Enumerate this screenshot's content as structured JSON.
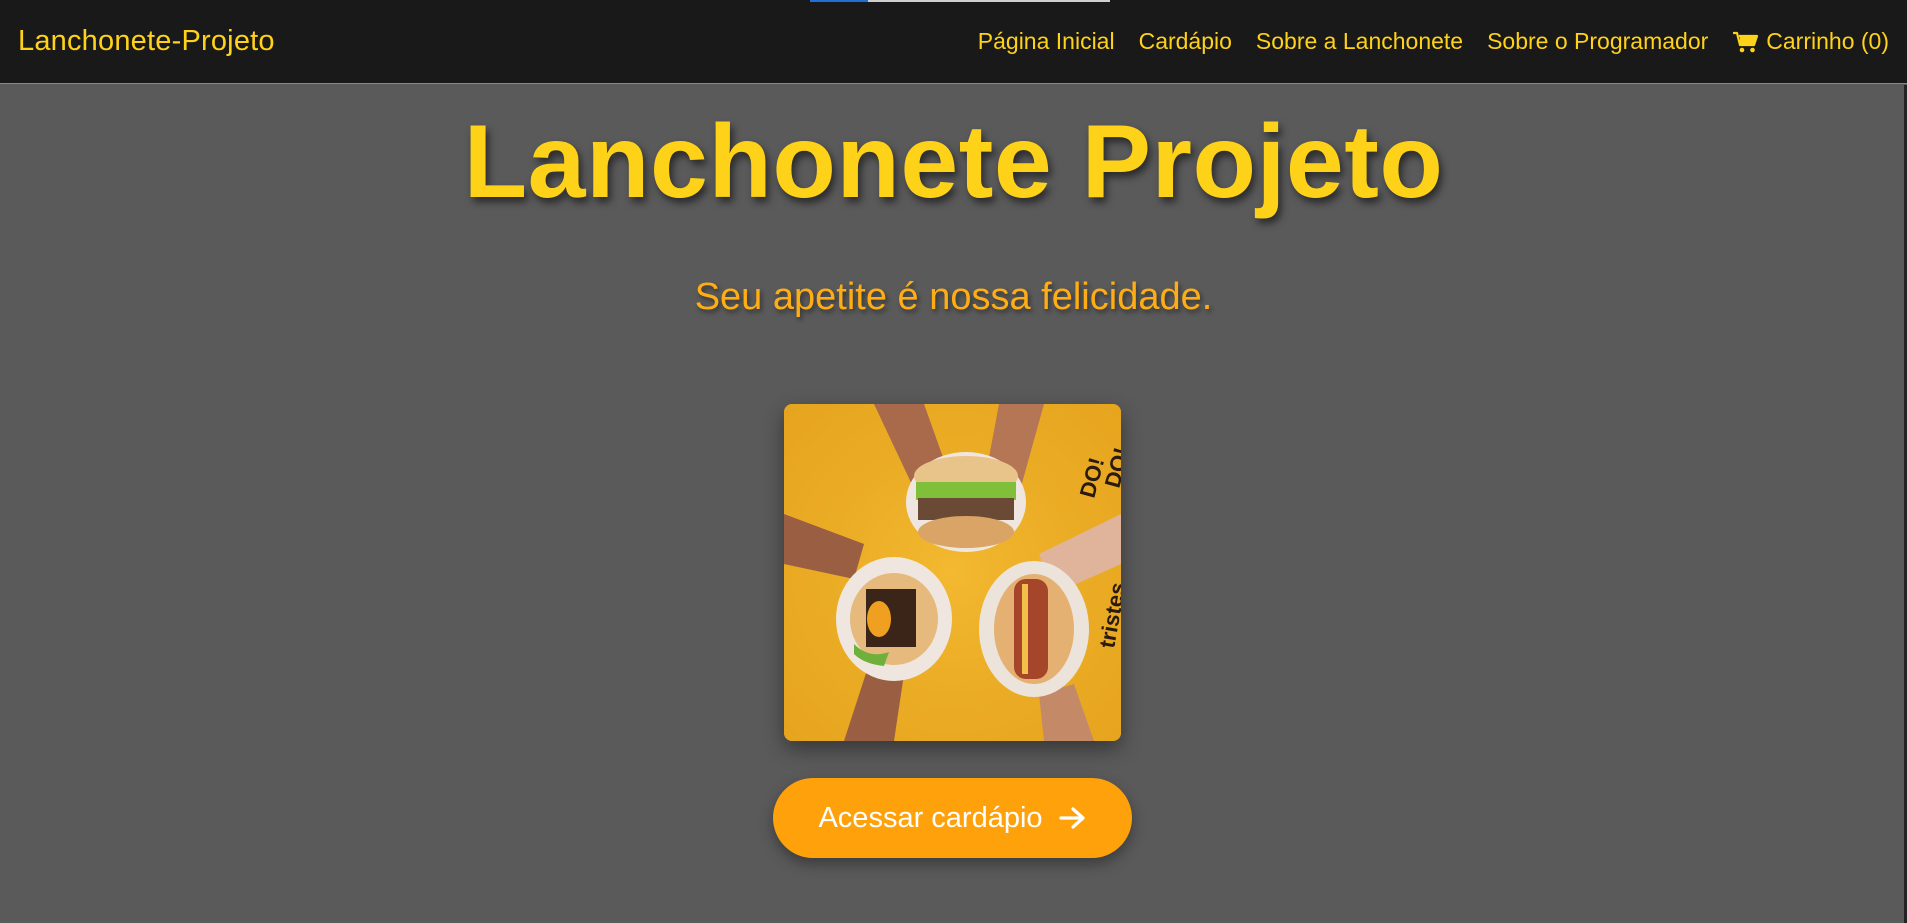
{
  "navbar": {
    "brand": "Lanchonete-Projeto",
    "links": [
      {
        "label": "Página Inicial"
      },
      {
        "label": "Cardápio"
      },
      {
        "label": "Sobre a Lanchonete"
      },
      {
        "label": "Sobre o Programador"
      }
    ],
    "cart": {
      "label": "Carrinho (0)",
      "icon": "shopping-cart-icon"
    }
  },
  "hero": {
    "title": "Lanchonete Projeto",
    "subtitle": "Seu apetite é nossa felicidade.",
    "image": {
      "icon": "burgers-photo",
      "printed_text": [
        "DO!",
        "DO!",
        "tristes,"
      ]
    },
    "cta": {
      "label": "Acessar cardápio",
      "icon": "arrow-right-icon"
    }
  },
  "colors": {
    "accent": "#ffd21a",
    "subtitle": "#ffad14",
    "button": "#ffa10a",
    "navbar_bg": "#191919",
    "page_bg": "#5a5a5a"
  }
}
